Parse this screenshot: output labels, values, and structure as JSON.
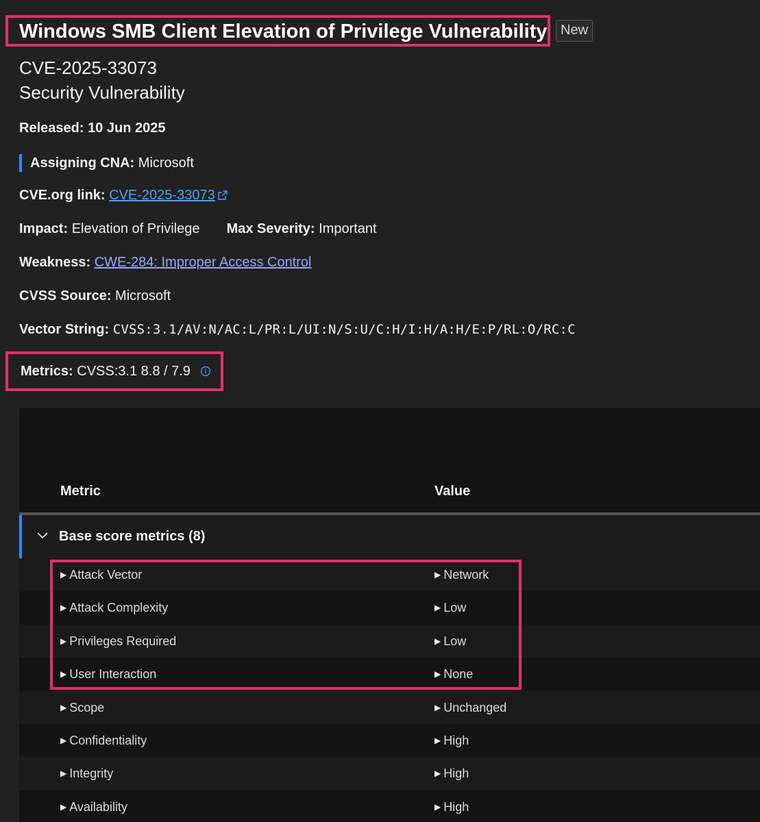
{
  "header": {
    "title": "Windows SMB Client Elevation of Privilege Vulnerability",
    "badge": "New",
    "cve_id": "CVE-2025-33073",
    "subtitle": "Security Vulnerability"
  },
  "details": {
    "released_label": "Released:",
    "released_value": "10 Jun 2025",
    "cna_label": "Assigning CNA:",
    "cna_value": "Microsoft",
    "cveorg_label": "CVE.org link:",
    "cveorg_value": "CVE-2025-33073",
    "impact_label": "Impact:",
    "impact_value": "Elevation of Privilege",
    "severity_label": "Max Severity:",
    "severity_value": "Important",
    "weakness_label": "Weakness:",
    "weakness_value": "CWE-284: Improper Access Control",
    "cvss_source_label": "CVSS Source:",
    "cvss_source_value": "Microsoft",
    "vector_label": "Vector String:",
    "vector_value": "CVSS:3.1/AV:N/AC:L/PR:L/UI:N/S:U/C:H/I:H/A:H/E:P/RL:O/RC:C",
    "metrics_label": "Metrics:",
    "metrics_value": "CVSS:3.1 8.8 / 7.9"
  },
  "table": {
    "col_metric": "Metric",
    "col_value": "Value",
    "group_label": "Base score metrics (8)",
    "rows": [
      {
        "metric": "Attack Vector",
        "value": "Network"
      },
      {
        "metric": "Attack Complexity",
        "value": "Low"
      },
      {
        "metric": "Privileges Required",
        "value": "Low"
      },
      {
        "metric": "User Interaction",
        "value": "None"
      },
      {
        "metric": "Scope",
        "value": "Unchanged"
      },
      {
        "metric": "Confidentiality",
        "value": "High"
      },
      {
        "metric": "Integrity",
        "value": "High"
      },
      {
        "metric": "Availability",
        "value": "High"
      }
    ]
  },
  "colors": {
    "background": "#212121",
    "highlight": "#e0306a",
    "accent": "#3a86ff",
    "link": "#4aa3ff"
  },
  "icons": {
    "external": "external-link-icon",
    "info": "info-icon",
    "chevron": "chevron-down-icon",
    "row_expand": "triangle-right-icon"
  }
}
